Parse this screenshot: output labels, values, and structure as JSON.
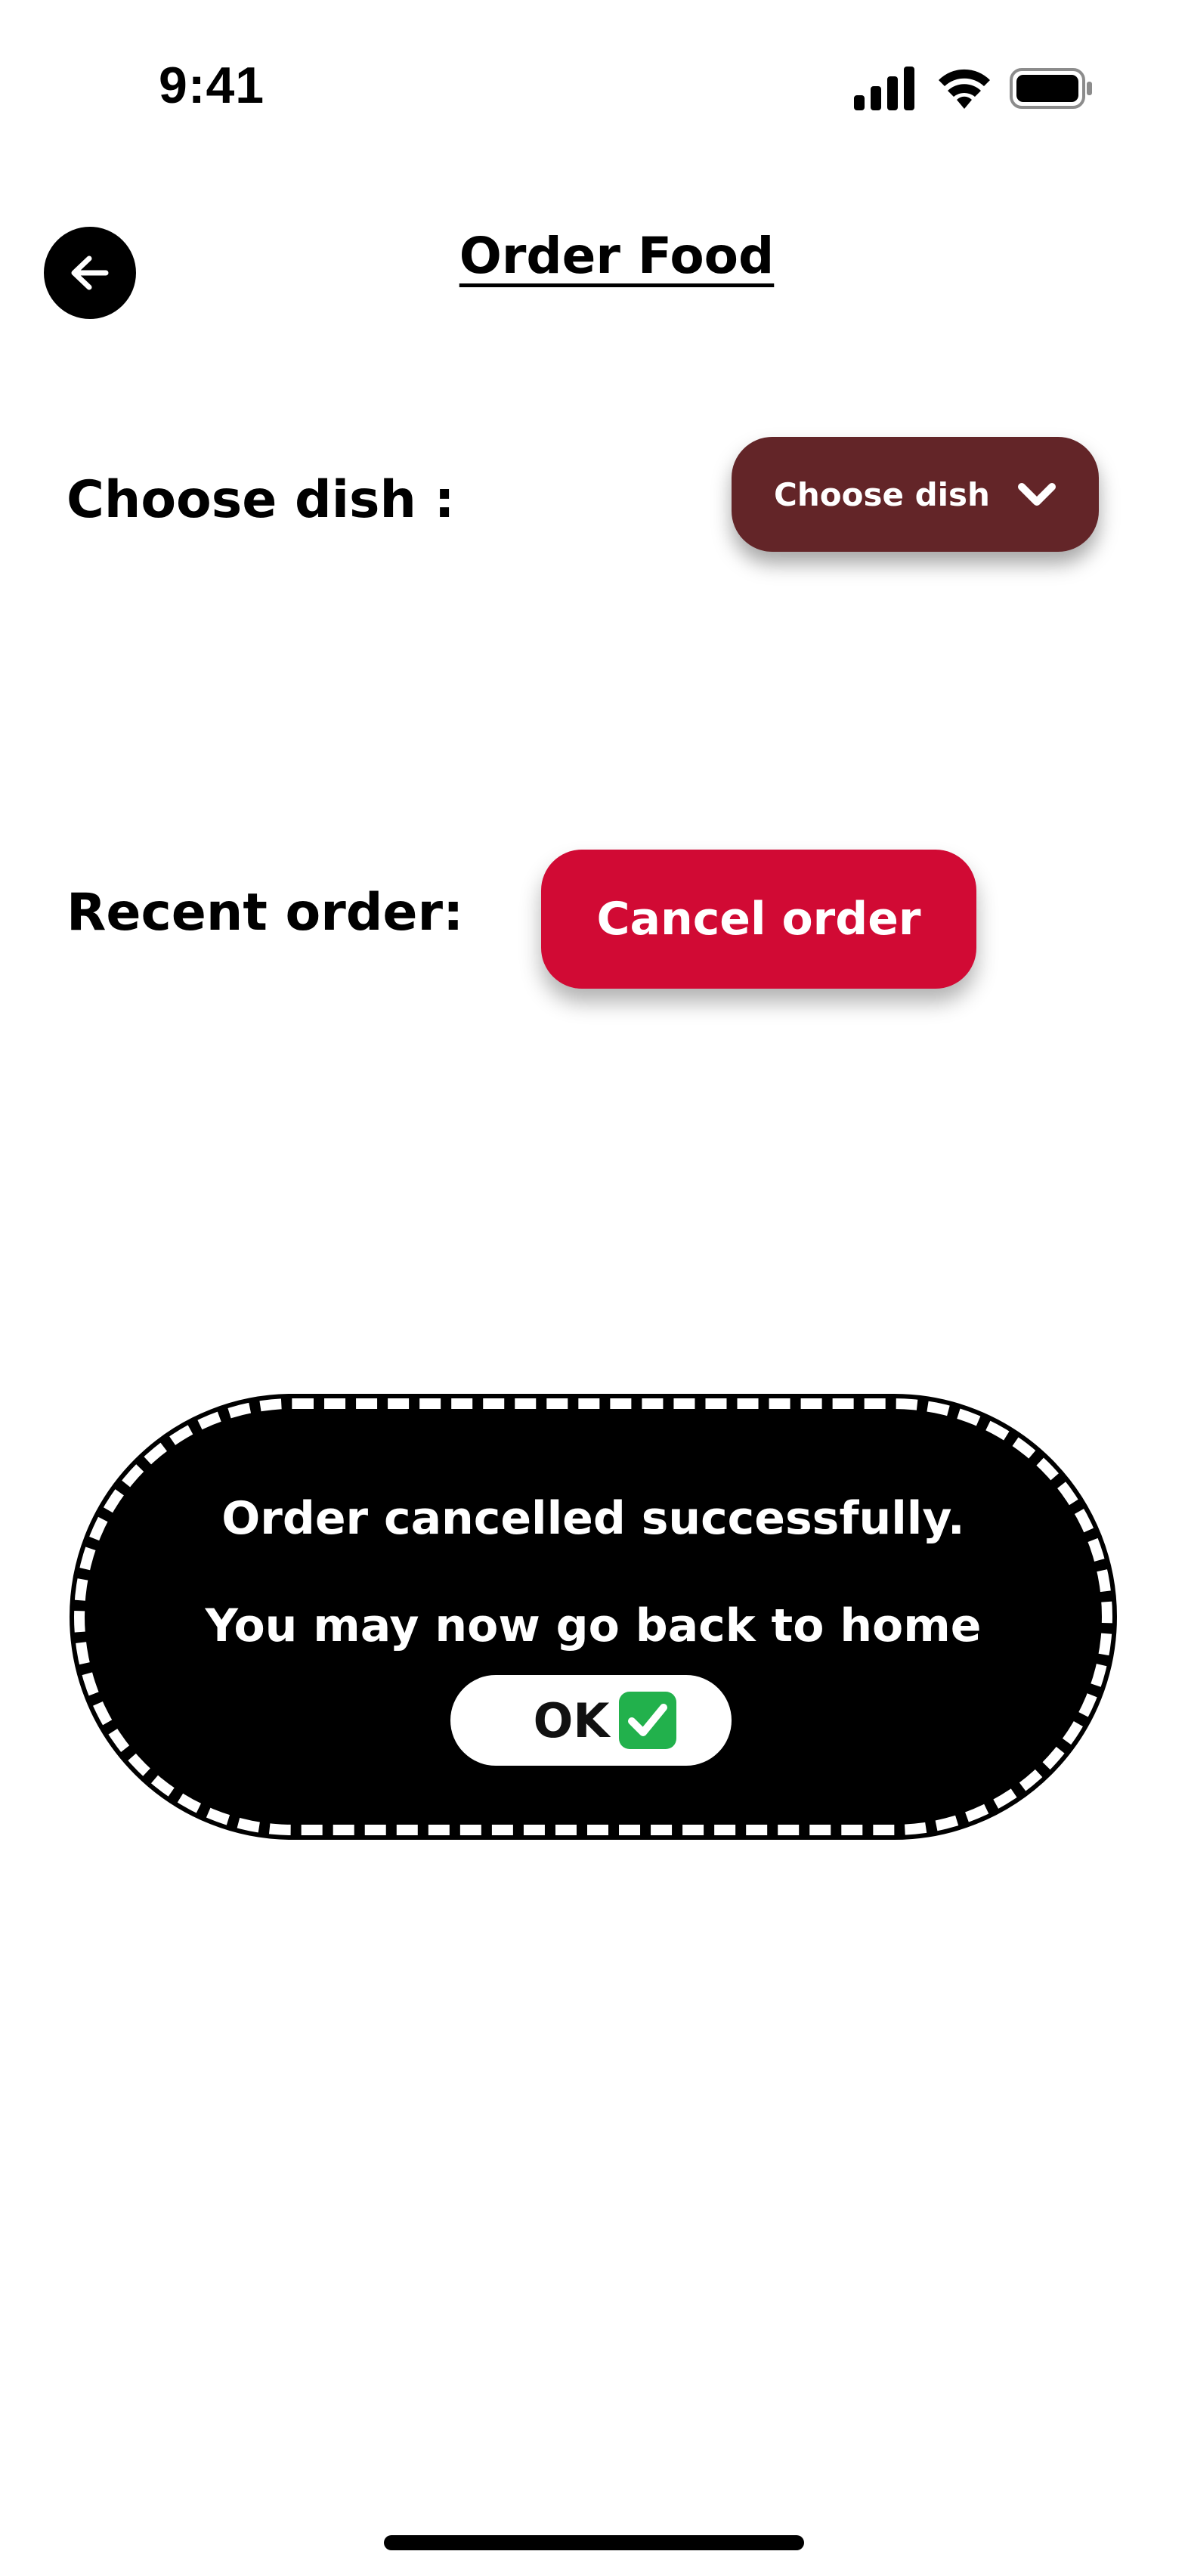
{
  "status_bar": {
    "time": "9:41"
  },
  "header": {
    "title": "Order Food"
  },
  "choose_dish": {
    "label": "Choose dish :",
    "button_label": "Choose dish"
  },
  "recent_order": {
    "label": "Recent order:",
    "cancel_button_label": "Cancel order"
  },
  "dialog": {
    "message_line1": "Order cancelled successfully.",
    "message_line2": "You may now go back to home",
    "ok_label": "OK"
  },
  "colors": {
    "choose_button": "#632528",
    "cancel_button": "#d10a34",
    "dialog_background": "#000000",
    "check_green": "#22b14c"
  },
  "icons": {
    "back": "arrow-left-icon",
    "dropdown": "chevron-down-icon",
    "ok": "check-box-icon"
  }
}
